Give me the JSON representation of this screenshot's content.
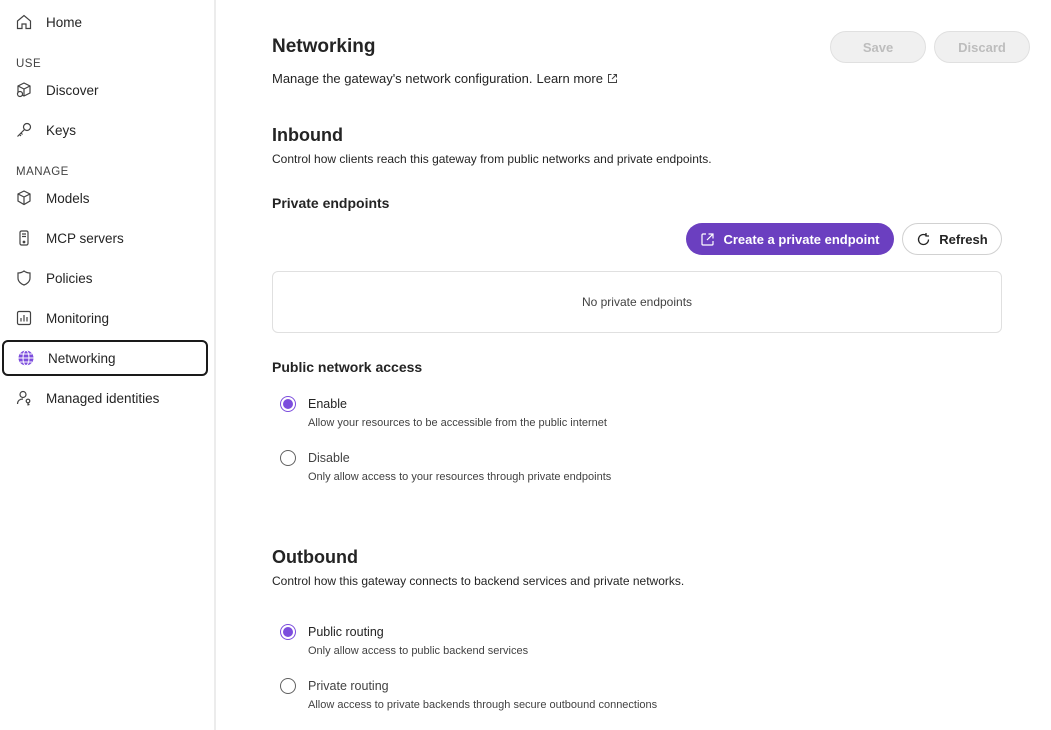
{
  "sidebar": {
    "home": "Home",
    "use_section": "USE",
    "discover": "Discover",
    "keys": "Keys",
    "manage_section": "MANAGE",
    "models": "Models",
    "mcp_servers": "MCP servers",
    "policies": "Policies",
    "monitoring": "Monitoring",
    "networking": "Networking",
    "managed_identities": "Managed identities"
  },
  "header": {
    "title": "Networking",
    "description": "Manage the gateway's network configuration.",
    "learn_more": "Learn more",
    "save_label": "Save",
    "discard_label": "Discard"
  },
  "inbound": {
    "title": "Inbound",
    "description": "Control how clients reach this gateway from public networks and private endpoints.",
    "private_endpoints_title": "Private endpoints",
    "create_button": "Create a private endpoint",
    "refresh_button": "Refresh",
    "empty_text": "No private endpoints",
    "public_access_title": "Public network access",
    "options": [
      {
        "label": "Enable",
        "sub": "Allow your resources to be accessible from the public internet",
        "selected": true
      },
      {
        "label": "Disable",
        "sub": "Only allow access to your resources through private endpoints",
        "selected": false
      }
    ]
  },
  "outbound": {
    "title": "Outbound",
    "description": "Control how this gateway connects to backend services and private networks.",
    "options": [
      {
        "label": "Public routing",
        "sub": "Only allow access to public backend services",
        "selected": true
      },
      {
        "label": "Private routing",
        "sub": "Allow access to private backends through secure outbound connections",
        "selected": false
      }
    ]
  },
  "colors": {
    "accent": "#6b3fc0",
    "radio_accent": "#7c4ddd"
  }
}
